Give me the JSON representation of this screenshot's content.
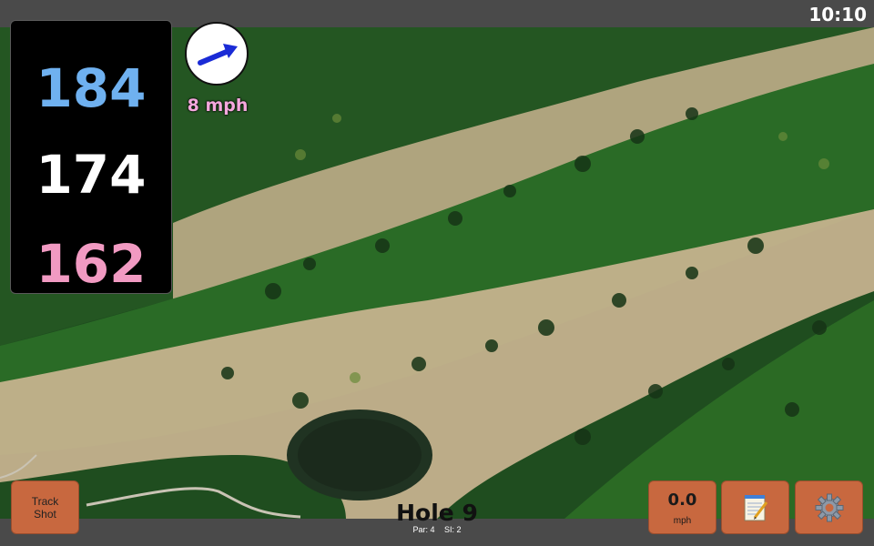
{
  "status": {
    "time": "10:10"
  },
  "distances": {
    "back": "184",
    "middle": "174",
    "front": "162"
  },
  "wind": {
    "speed_text": "8 mph",
    "icon": "wind-arrow-icon"
  },
  "buttons": {
    "track_shot_line1": "Track",
    "track_shot_line2": "Shot",
    "speed_value": "0.0",
    "speed_unit": "mph",
    "notes_icon": "notepad-icon",
    "settings_icon": "gear-icon"
  },
  "hole": {
    "title": "Hole 9",
    "par": "Par: 4",
    "si": "SI: 2"
  },
  "colors": {
    "back": "#6fb1f0",
    "middle": "#ffffff",
    "front": "#f19ac2",
    "button": "#c8683f",
    "wind_text": "#f4a8dd"
  }
}
